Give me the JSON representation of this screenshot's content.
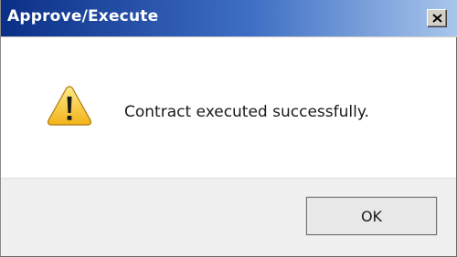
{
  "dialog": {
    "title": "Approve/Execute",
    "message": "Contract executed successfully.",
    "ok_label": "OK",
    "icon": "warning-icon",
    "close_icon": "close-icon"
  },
  "colors": {
    "titlebar_start": "#0b2f87",
    "titlebar_end": "#a9c6ec",
    "footer_bg": "#f0f0f0",
    "warning_yellow": "#f6c233"
  }
}
